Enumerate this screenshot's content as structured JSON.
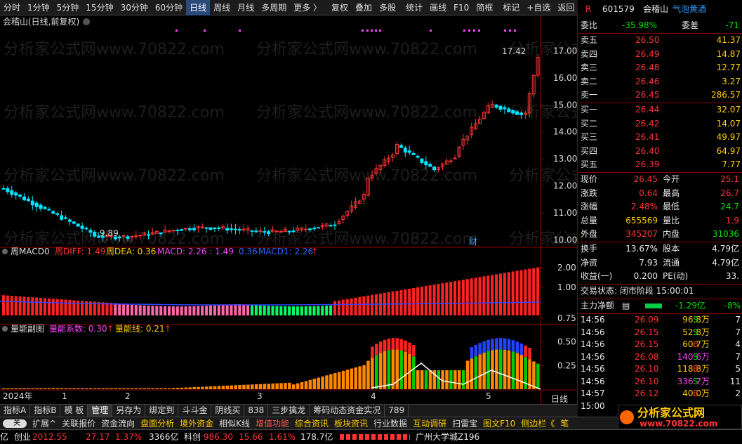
{
  "toolbar": {
    "items": [
      "分时",
      "1分钟",
      "5分钟",
      "15分钟",
      "30分钟",
      "60分钟",
      "日线",
      "周线",
      "月线",
      "多周期",
      "更多 〉",
      "复权",
      "叠加",
      "多股",
      "统计",
      "画线",
      "F10",
      "简框",
      "标记",
      "+自选",
      "返回"
    ],
    "active": "日线"
  },
  "chart": {
    "title": "会稽山(日线,前复权)",
    "watermark": "分析家公式网www.70822.com",
    "price_axis": [
      "17.00",
      "16.00",
      "15.00",
      "14.00",
      "13.00",
      "12.00",
      "11.00",
      "10.00"
    ],
    "high_label": "17.42",
    "low_label": "9.89",
    "finance_marker": "财",
    "macd_legend": {
      "name": "周MACD0",
      "diff_label": "周DIFF: 1.49",
      "dea_label": "周DEA: 0.36",
      "macd_label": "MACD: 2.26 : 1.49",
      "v2": "0.36",
      "macd1": "MACD1: 2.26",
      "arrow": "↑"
    },
    "macd_axis": [
      "2.00",
      "1.00"
    ],
    "vol_legend": {
      "name": "量能副图",
      "coef_label": "量能系数: 0.30",
      "arrow1": "↑",
      "line_label": "量能线: 0.21",
      "arrow2": "↑"
    },
    "vol_axis": [
      "0.75",
      "0.50",
      "0.25"
    ],
    "date_axis": [
      "2024年",
      "1",
      "2",
      "3",
      "4",
      "5"
    ],
    "period_label": "日线"
  },
  "quote": {
    "code": "601579",
    "name": "会稽山",
    "tag": "气泡黄酒",
    "weibi_label": "委比",
    "weibi": "-35.98%",
    "weicha_label": "委差",
    "weicha": "-71",
    "asks": [
      {
        "label": "卖五",
        "price": "26.50",
        "vol": "41.37"
      },
      {
        "label": "卖四",
        "price": "26.49",
        "vol": "14.87"
      },
      {
        "label": "卖三",
        "price": "26.48",
        "vol": "12.77"
      },
      {
        "label": "卖二",
        "price": "26.46",
        "vol": "3.27"
      },
      {
        "label": "卖一",
        "price": "26.45",
        "vol": "286.57"
      }
    ],
    "bids": [
      {
        "label": "买一",
        "price": "26.44",
        "vol": "32.07"
      },
      {
        "label": "买二",
        "price": "26.42",
        "vol": "14.07"
      },
      {
        "label": "买三",
        "price": "26.41",
        "vol": "49.97"
      },
      {
        "label": "买四",
        "price": "26.40",
        "vol": "64.97"
      },
      {
        "label": "买五",
        "price": "26.39",
        "vol": "7.77"
      }
    ],
    "stats": [
      {
        "l1": "现价",
        "v1": "26.45",
        "l2": "今开",
        "v2": "25.1",
        "c1": "red",
        "c2": "red"
      },
      {
        "l1": "涨跌",
        "v1": "0.64",
        "l2": "最高",
        "v2": "26.7",
        "c1": "red",
        "c2": "red"
      },
      {
        "l1": "涨幅",
        "v1": "2.48%",
        "l2": "最低",
        "v2": "24.7",
        "c1": "red",
        "c2": "green"
      },
      {
        "l1": "总量",
        "v1": "655569",
        "l2": "量比",
        "v2": "1.9",
        "c1": "yel",
        "c2": "red"
      },
      {
        "l1": "外盘",
        "v1": "345207",
        "l2": "内盘",
        "v2": "31036",
        "c1": "red",
        "c2": "green"
      }
    ],
    "stats2": [
      {
        "l1": "换手",
        "v1": "13.67%",
        "l2": "股本",
        "v2": "4.79亿"
      },
      {
        "l1": "净资",
        "v1": "7.93",
        "l2": "流通",
        "v2": "4.79亿"
      },
      {
        "l1": "收益(一)",
        "v1": "0.200",
        "l2": "PE(动)",
        "v2": "33."
      }
    ],
    "trade_status": "交易状态: 闭市阶段 15:00:01",
    "flow_label": "主力净额",
    "flow_value": "-1.29亿",
    "flow_pct": "-8%",
    "ticks": [
      {
        "t": "14:56",
        "p": "26.09",
        "v": "96.8万",
        "s": "S",
        "n": "7",
        "pc": "red",
        "vc": "yel",
        "sc": "green"
      },
      {
        "t": "14:56",
        "p": "26.15",
        "v": "52.8万",
        "s": "S",
        "n": "7",
        "pc": "red",
        "vc": "yel",
        "sc": "green"
      },
      {
        "t": "14:56",
        "p": "26.15",
        "v": "60.7万",
        "s": "B",
        "n": "4",
        "pc": "red",
        "vc": "yel",
        "sc": "red"
      },
      {
        "t": "14:56",
        "p": "26.08",
        "v": "140.6万",
        "s": "S",
        "n": "7",
        "pc": "red",
        "vc": "mag",
        "sc": "green"
      },
      {
        "t": "14:56",
        "p": "26.10",
        "v": "118.8万",
        "s": "B",
        "n": "5",
        "pc": "red",
        "vc": "yel",
        "sc": "red"
      },
      {
        "t": "14:56",
        "p": "26.10",
        "v": "336.7万",
        "s": "S",
        "n": "11",
        "pc": "red",
        "vc": "mag",
        "sc": "green"
      },
      {
        "t": "14:57",
        "p": "26.12",
        "v": "40.0万",
        "s": "B",
        "n": "2",
        "pc": "red",
        "vc": "yel",
        "sc": "red"
      },
      {
        "t": "15:00",
        "p": "",
        "v": "",
        "s": "",
        "n": "",
        "pc": "red",
        "vc": "yel",
        "sc": "red"
      }
    ]
  },
  "tabs1": {
    "items": [
      "指标A",
      "指标B",
      "模 板",
      "管理",
      "另存为",
      "绑定到",
      "斗斗金",
      "阴线买",
      "838",
      "三步擒龙",
      "筹码动态资金实况",
      "789"
    ],
    "active": "管理"
  },
  "tabs2": {
    "items": [
      {
        "t": "扩展^",
        "c": ""
      },
      {
        "t": "关联报价",
        "c": ""
      },
      {
        "t": "资金流向",
        "c": ""
      },
      {
        "t": "盘面分析",
        "c": "y"
      },
      {
        "t": "境外资金",
        "c": "y"
      },
      {
        "t": "相似K线",
        "c": ""
      },
      {
        "t": "增值功能",
        "c": "r"
      },
      {
        "t": "综合资讯",
        "c": "y"
      },
      {
        "t": "板块资讯",
        "c": "y"
      },
      {
        "t": "行业数据",
        "c": ""
      },
      {
        "t": "互动调研",
        "c": "y"
      },
      {
        "t": "扫雷宝",
        "c": ""
      },
      {
        "t": "图文F10",
        "c": "y"
      },
      {
        "t": "侧边栏《",
        "c": "y"
      },
      {
        "t": "笔",
        "c": "y"
      }
    ],
    "toggle_label": "关"
  },
  "status": {
    "prefix": "亿",
    "chuangye_label": "创业",
    "chuangye": "2012.55",
    "cy_chg": "27.17",
    "cy_pct": "1.37%",
    "cy_amt": "3366亿",
    "kechuang_label": "科创",
    "kechuang": "986.30",
    "kc_chg": "15.66",
    "kc_pct": "1.61%",
    "kc_amt": "178.7亿",
    "ticker": "广州大学城Z196"
  },
  "logo": {
    "text": "分析家公式网",
    "url": "www.70822.com"
  },
  "chart_data": {
    "type": "candlestick",
    "x_start_label": "2024年",
    "price_range": [
      9.89,
      17.42
    ],
    "last": 26.45
  }
}
